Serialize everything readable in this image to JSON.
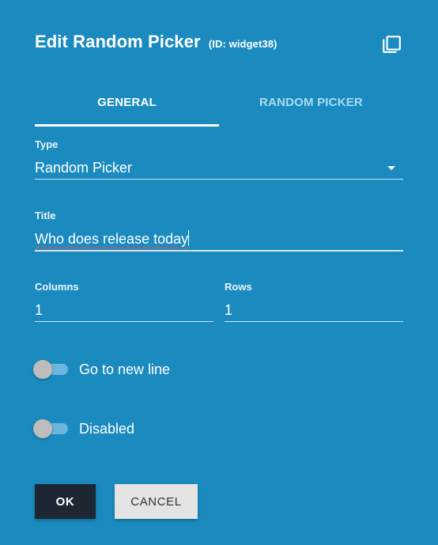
{
  "header": {
    "title": "Edit Random Picker",
    "id_label": "(ID: widget38)",
    "copy_icon": "copy-icon"
  },
  "tabs": [
    {
      "label": "GENERAL",
      "active": true
    },
    {
      "label": "RANDOM PICKER",
      "active": false
    }
  ],
  "fields": {
    "type": {
      "label": "Type",
      "value": "Random Picker"
    },
    "title": {
      "label": "Title",
      "value": "Who does release today"
    },
    "columns": {
      "label": "Columns",
      "value": "1"
    },
    "rows": {
      "label": "Rows",
      "value": "1"
    }
  },
  "toggles": {
    "new_line": {
      "label": "Go to new line",
      "checked": false
    },
    "disabled": {
      "label": "Disabled",
      "checked": false
    }
  },
  "buttons": {
    "ok": "OK",
    "cancel": "CANCEL"
  },
  "colors": {
    "background": "#1b8bbf",
    "ok_button": "#1c2733",
    "cancel_button": "#e4e4e4"
  }
}
